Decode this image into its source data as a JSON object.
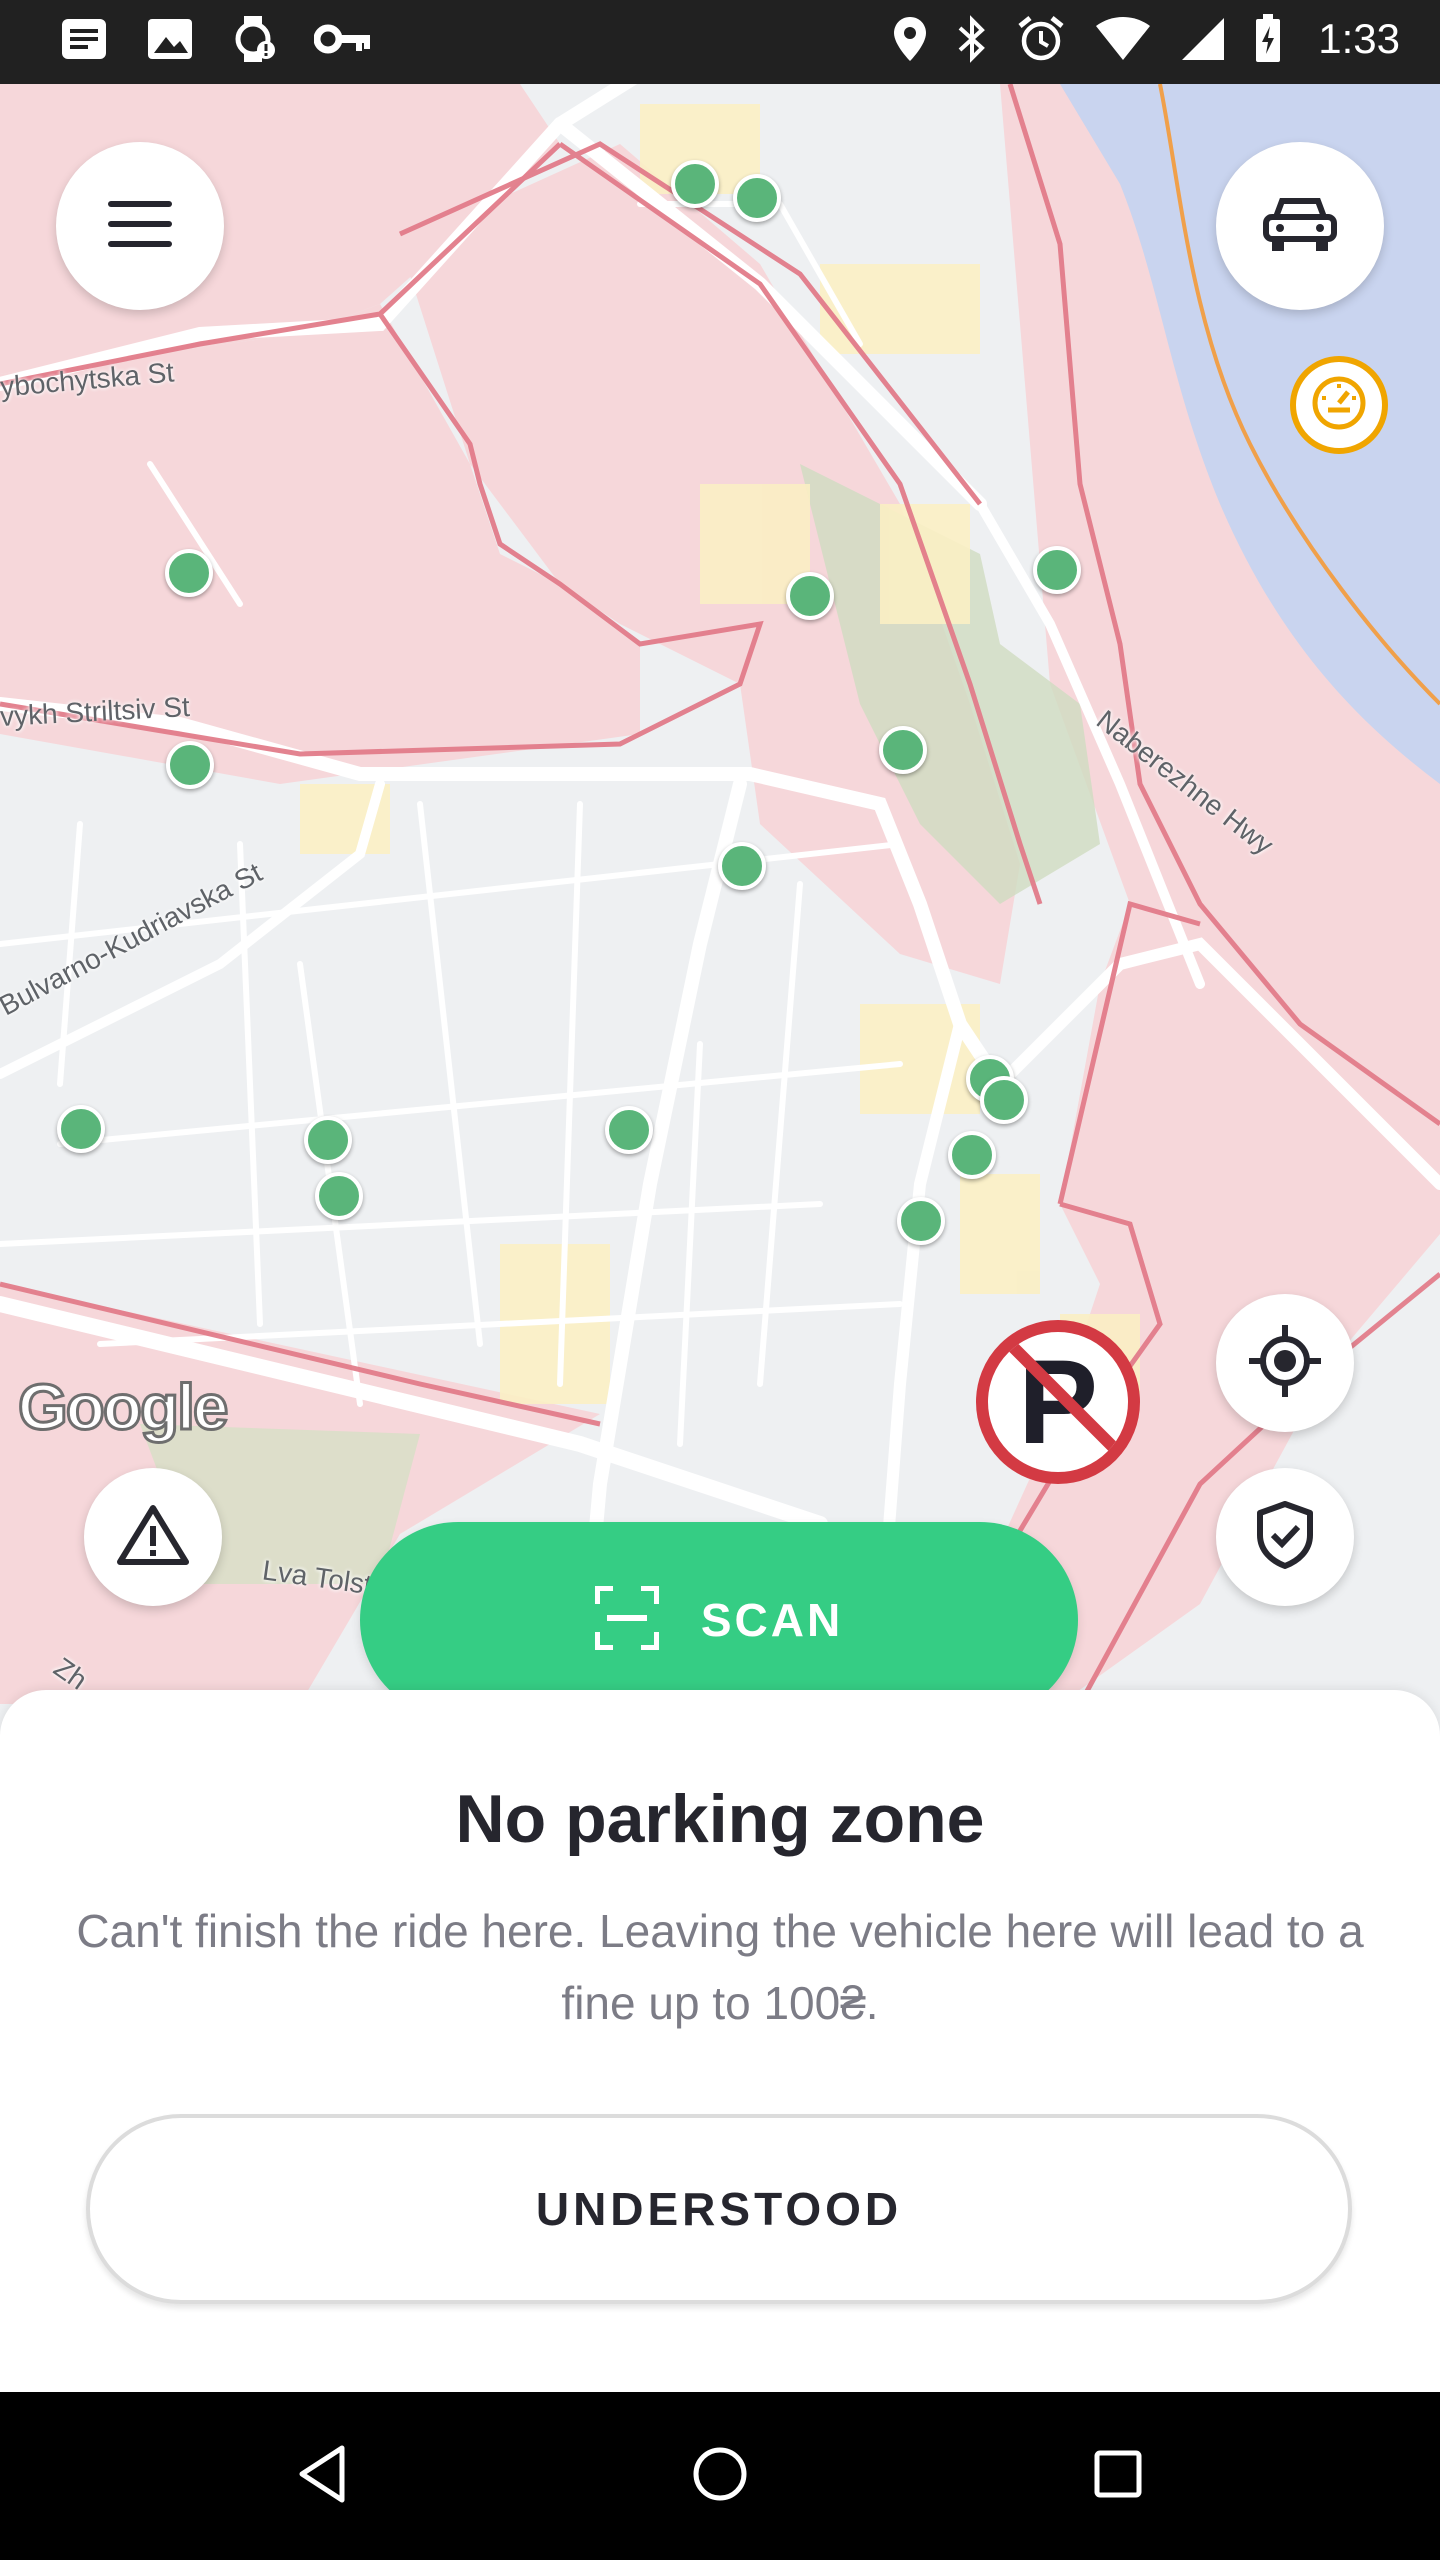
{
  "status_bar": {
    "time": "1:33",
    "left_icons": [
      "notes-icon",
      "image-icon",
      "watch-alert-icon",
      "key-icon"
    ],
    "right_icons": [
      "location-icon",
      "bluetooth-icon",
      "alarm-icon",
      "wifi-icon",
      "signal-icon",
      "battery-icon"
    ]
  },
  "map": {
    "street_labels": [
      "ybochytska St",
      "vykh Striltsiv St",
      "Bulvarno-Kudriavska St",
      "Naberezhne Hwy",
      "Lva Tolston",
      "Zh"
    ],
    "attribution": "Google",
    "colors": {
      "restricted_zone": "#f6d7da",
      "zone_border": "#e27c8a",
      "river": "#c9d4ef",
      "marker": "#5ab57a",
      "park": "#cfdcc0"
    }
  },
  "controls": {
    "menu_icon": "hamburger-menu-icon",
    "vehicle_icon": "car-icon",
    "speed_icon": "speedometer-icon",
    "report_icon": "warning-triangle-icon",
    "locate_icon": "crosshair-locate-icon",
    "safety_icon": "shield-check-icon",
    "no_parking_icon": "no-parking-icon"
  },
  "scan_button": {
    "label": "SCAN",
    "icon": "scan-frame-icon",
    "color": "#35cd84"
  },
  "sheet": {
    "title": "No parking zone",
    "body": "Can't finish the ride here. Leaving the vehicle here will lead to a fine up to 100₴.",
    "button_label": "UNDERSTOOD"
  },
  "nav_bar": {
    "buttons": [
      "back-icon",
      "home-icon",
      "recents-icon"
    ]
  }
}
